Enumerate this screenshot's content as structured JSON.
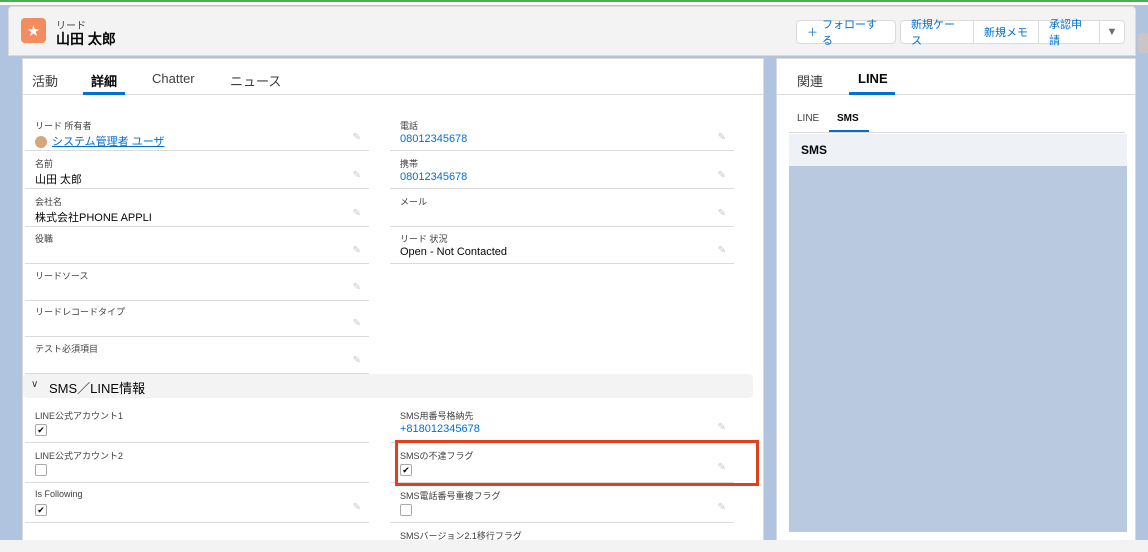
{
  "header": {
    "object_type": "リード",
    "record_name": "山田 太郎",
    "icon": "person-star-icon",
    "buttons": {
      "follow": "フォローする",
      "new_case": "新規ケース",
      "new_memo": "新規メモ",
      "approval": "承認申請"
    }
  },
  "left_tabs": [
    "活動",
    "詳細",
    "Chatter",
    "ニュース"
  ],
  "fields": {
    "owner_label": "リード 所有者",
    "owner_value": "システム管理者 ユーザ",
    "phone_label": "電話",
    "phone_value": "08012345678",
    "name_label": "名前",
    "name_value": "山田 太郎",
    "mobile_label": "携帯",
    "mobile_value": "08012345678",
    "company_label": "会社名",
    "company_value": "株式会社PHONE APPLI",
    "email_label": "メール",
    "title_label": "役職",
    "status_label": "リード 状況",
    "status_value": "Open - Not Contacted",
    "source_label": "リードソース",
    "record_type_label": "リードレコードタイプ",
    "test_required_label": "テスト必須項目"
  },
  "section": {
    "title": "SMS／LINE情報",
    "line_account1_label": "LINE公式アカウント1",
    "line_account1_checked": true,
    "sms_number_label": "SMS用番号格納先",
    "sms_number_value": "+818012345678",
    "line_account2_label": "LINE公式アカウント2",
    "line_account2_checked": false,
    "sms_undeliverable_label": "SMSの不達フラグ",
    "sms_undeliverable_checked": true,
    "is_following_label": "Is Following",
    "is_following_checked": true,
    "sms_duplicate_label": "SMS電話番号重複フラグ",
    "sms_duplicate_checked": false,
    "sms_version_label": "SMSバージョン2.1移行フラグ"
  },
  "right_tabs": [
    "関連",
    "LINE"
  ],
  "right_subtabs": [
    "LINE",
    "SMS"
  ],
  "sms_panel_title": "SMS",
  "checkmark": "✔",
  "pencil": "✎",
  "colors": {
    "brand_blue": "#0070d2",
    "highlight_red": "#e0401d",
    "lead_icon": "#f38c5e"
  }
}
